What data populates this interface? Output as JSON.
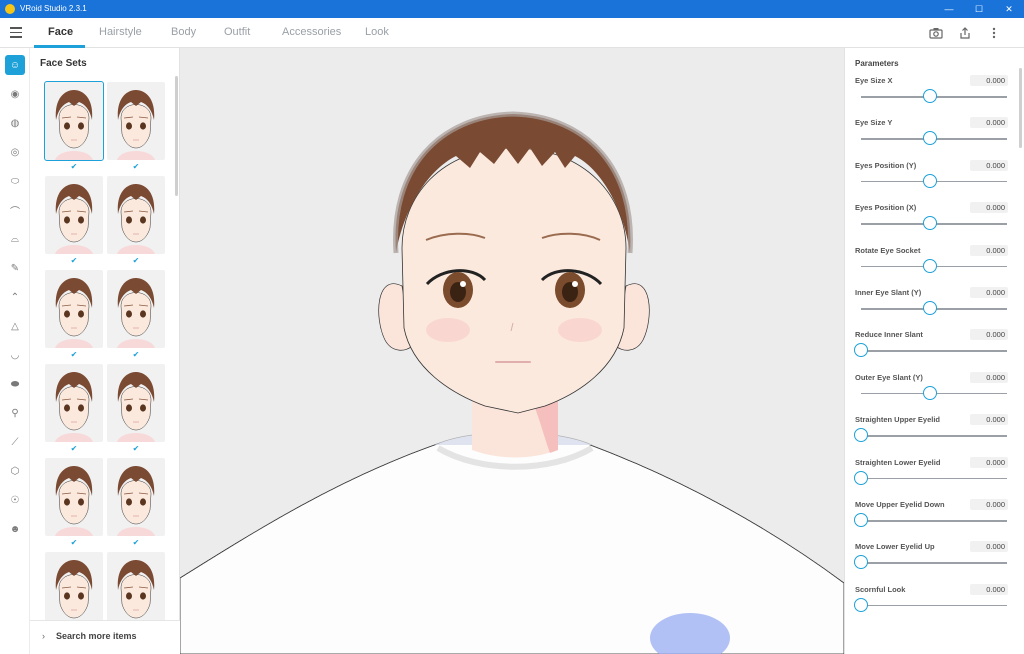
{
  "window": {
    "title": "VRoid Studio 2.3.1"
  },
  "tabs": [
    {
      "label": "Face",
      "active": true
    },
    {
      "label": "Hairstyle",
      "active": false
    },
    {
      "label": "Body",
      "active": false
    },
    {
      "label": "Outfit",
      "active": false
    },
    {
      "label": "Accessories",
      "active": false
    },
    {
      "label": "Look",
      "active": false
    }
  ],
  "toolbar_icons": [
    "camera-icon",
    "export-icon",
    "more-vertical-icon"
  ],
  "left_rail_icons": [
    "face-icon",
    "eye-icon",
    "iris-icon",
    "eye-highlight-icon",
    "eye-white-icon",
    "eyebrow-icon",
    "eyelash-icon",
    "eyeliner-icon",
    "eyelid-icon",
    "nose-icon",
    "mouth-icon",
    "tooth-icon",
    "ear-icon",
    "brush-icon",
    "face-shape-icon",
    "head-icon",
    "cheek-icon"
  ],
  "face_sets": {
    "title": "Face Sets",
    "search_more": "Search more items",
    "thumbs": [
      {
        "checked": true,
        "selected": true
      },
      {
        "checked": true,
        "selected": false
      },
      {
        "checked": true,
        "selected": false
      },
      {
        "checked": true,
        "selected": false
      },
      {
        "checked": true,
        "selected": false
      },
      {
        "checked": true,
        "selected": false
      },
      {
        "checked": true,
        "selected": false
      },
      {
        "checked": true,
        "selected": false
      },
      {
        "checked": true,
        "selected": false
      },
      {
        "checked": true,
        "selected": false
      },
      {
        "checked": false,
        "selected": false
      },
      {
        "checked": false,
        "selected": false
      }
    ]
  },
  "parameters": {
    "title": "Parameters",
    "items": [
      {
        "label": "Eye Size X",
        "value": "0.000",
        "level": 0.5
      },
      {
        "label": "Eye Size Y",
        "value": "0.000",
        "level": 0.5
      },
      {
        "label": "Eyes Position (Y)",
        "value": "0.000",
        "level": 0.5
      },
      {
        "label": "Eyes Position (X)",
        "value": "0.000",
        "level": 0.5
      },
      {
        "label": "Rotate Eye Socket",
        "value": "0.000",
        "level": 0.5
      },
      {
        "label": "Inner Eye Slant (Y)",
        "value": "0.000",
        "level": 0.5
      },
      {
        "label": "Reduce Inner Slant",
        "value": "0.000",
        "level": 0.0
      },
      {
        "label": "Outer Eye Slant (Y)",
        "value": "0.000",
        "level": 0.5
      },
      {
        "label": "Straighten Upper Eyelid",
        "value": "0.000",
        "level": 0.0
      },
      {
        "label": "Straighten Lower Eyelid",
        "value": "0.000",
        "level": 0.0
      },
      {
        "label": "Move Upper Eyelid Down",
        "value": "0.000",
        "level": 0.0
      },
      {
        "label": "Move Lower Eyelid Up",
        "value": "0.000",
        "level": 0.0
      },
      {
        "label": "Scornful Look",
        "value": "0.000",
        "level": 0.0
      }
    ]
  },
  "colors": {
    "accent": "#1da1d8",
    "titlebar": "#1a73d9",
    "hair": "#7a4a32",
    "skin": "#fbe9de"
  }
}
